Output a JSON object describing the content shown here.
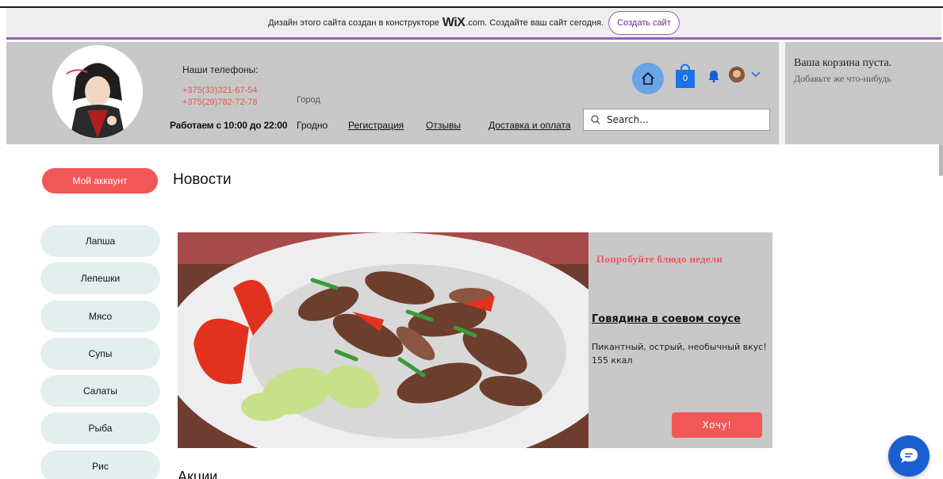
{
  "banner": {
    "text_before": "Дизайн этого сайта создан в конструкторе",
    "wix_logo": "WiX",
    "text_after": ".com. Создайте ваш сайт сегодня.",
    "button_label": "Создать сайт"
  },
  "header": {
    "phones_title": "Наши телефоны:",
    "phone1": "+375(33)321-67-54",
    "phone2": "+375(29)782-72-78",
    "hours": "Работаем с 10:00 до 22:00",
    "city_label": "Город",
    "city": "Гродно",
    "nav": {
      "register": "Регистрация",
      "reviews": "Отзывы",
      "delivery": "Доставка и оплата"
    },
    "cart_count": "0",
    "search_placeholder": "Search...",
    "accent_color": "#6aa3e8",
    "cart_color": "#1a73e8"
  },
  "cart_panel": {
    "empty": "Ваша корзина пуста.",
    "hint": "Добавьте же что-нибудь"
  },
  "main": {
    "account_button": "Мой аккаунт",
    "page_title": "Новости",
    "menu": [
      {
        "label": "Лапша"
      },
      {
        "label": "Лепешки"
      },
      {
        "label": "Мясо"
      },
      {
        "label": "Супы"
      },
      {
        "label": "Салаты"
      },
      {
        "label": "Рыба"
      },
      {
        "label": "Рис"
      }
    ],
    "feature": {
      "tag": "Попробуйте блюдо недели",
      "name": "Говядина в соевом соусе",
      "description": "Пикантный, острый, необычный вкус!",
      "kcal": "155 ккал",
      "button": "Хочу!"
    },
    "promo_title": "Акции"
  },
  "colors": {
    "accent_red": "#f25757",
    "header_gray": "#c8c8c8",
    "menu_bg": "#e3eeee",
    "chat_blue": "#1a5fd0"
  },
  "icons": {
    "home": "home-icon",
    "cart": "shopping-bag-icon",
    "bell": "bell-icon",
    "chevron": "chevron-down-icon",
    "search": "search-icon",
    "chat": "chat-icon"
  }
}
